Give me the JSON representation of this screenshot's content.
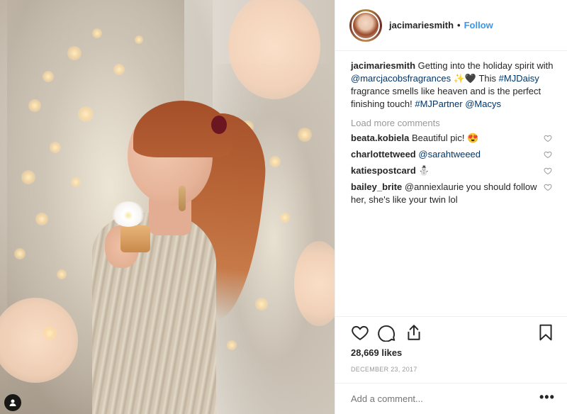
{
  "post": {
    "username": "jacimariesmith",
    "follow_label": "Follow",
    "caption": {
      "username": "jacimariesmith",
      "text_1": "Getting into the holiday spirit with",
      "mention": "@marcjacobsfragrances",
      "emoji": "✨🖤",
      "text_2": "This",
      "hashtag_1": "#MJDaisy",
      "text_3": "fragrance smells like heaven and is the perfect finishing touch!",
      "hashtag_2": "#MJPartner",
      "mention_2": "@Macys"
    },
    "load_more_label": "Load more comments",
    "comments": [
      {
        "username": "beata.kobiela",
        "text": "Beautiful pic! 😍"
      },
      {
        "username": "charlottetweed",
        "text": "@sarahtweeed"
      },
      {
        "username": "katiespostcard",
        "text": "⛄"
      },
      {
        "username": "bailey_brite",
        "text": "@anniexlaurie you should follow her, she's like your twin lol"
      }
    ],
    "likes": "28,669 likes",
    "date": "DECEMBER 23, 2017",
    "add_comment_placeholder": "Add a comment...",
    "more_label": "•••"
  },
  "icons": {
    "like": "heart-icon",
    "comment": "comment-icon",
    "share": "share-icon",
    "save": "bookmark-icon",
    "user_tag": "user-tag-icon"
  },
  "colors": {
    "link": "#003569",
    "follow": "#3897f0",
    "muted": "#999999"
  }
}
